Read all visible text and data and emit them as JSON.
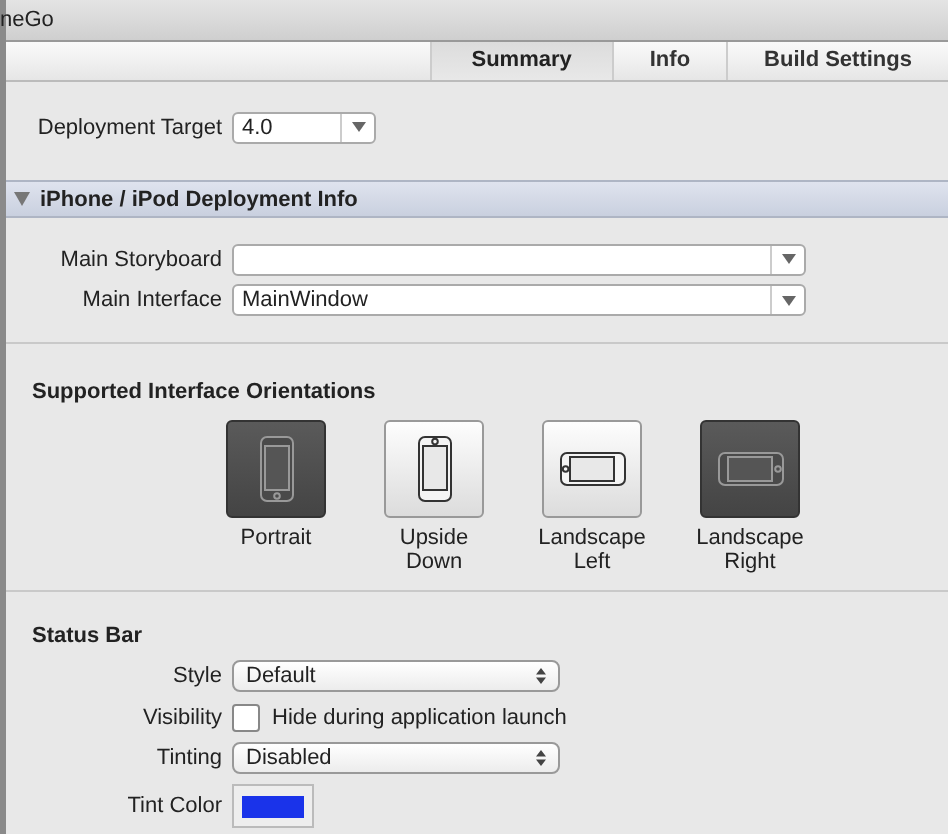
{
  "window": {
    "title": "neGo"
  },
  "tabs": [
    {
      "label": "Summary",
      "selected": true
    },
    {
      "label": "Info",
      "selected": false
    },
    {
      "label": "Build Settings",
      "selected": false
    }
  ],
  "deployment_target": {
    "label": "Deployment Target",
    "value": "4.0"
  },
  "deployment_info": {
    "title": "iPhone / iPod Deployment Info",
    "expanded": true,
    "fields": [
      {
        "label": "Main Storyboard"
      },
      {
        "label": "Main Interface",
        "value": "MainWindow"
      }
    ]
  },
  "orientations": {
    "title": "Supported Interface Orientations",
    "items": [
      {
        "kind": "portrait",
        "label": "Portrait",
        "selected": true
      },
      {
        "kind": "upside-down",
        "label": "Upside Down",
        "selected": false
      },
      {
        "kind": "landscape-left",
        "label": "Landscape Left",
        "selected": false
      },
      {
        "kind": "landscape-right",
        "label": "Landscape Right",
        "selected": true
      }
    ]
  },
  "status_bar": {
    "title": "Status Bar",
    "rows": [
      {
        "kind": "popup",
        "label": "Style",
        "value": "Default"
      },
      {
        "kind": "checkbox",
        "label": "Visibility",
        "text": "Hide during application launch",
        "checked": false
      },
      {
        "kind": "popup",
        "label": "Tinting",
        "value": "Disabled"
      },
      {
        "kind": "color",
        "label": "Tint Color",
        "color": "#1a33ea"
      }
    ]
  }
}
